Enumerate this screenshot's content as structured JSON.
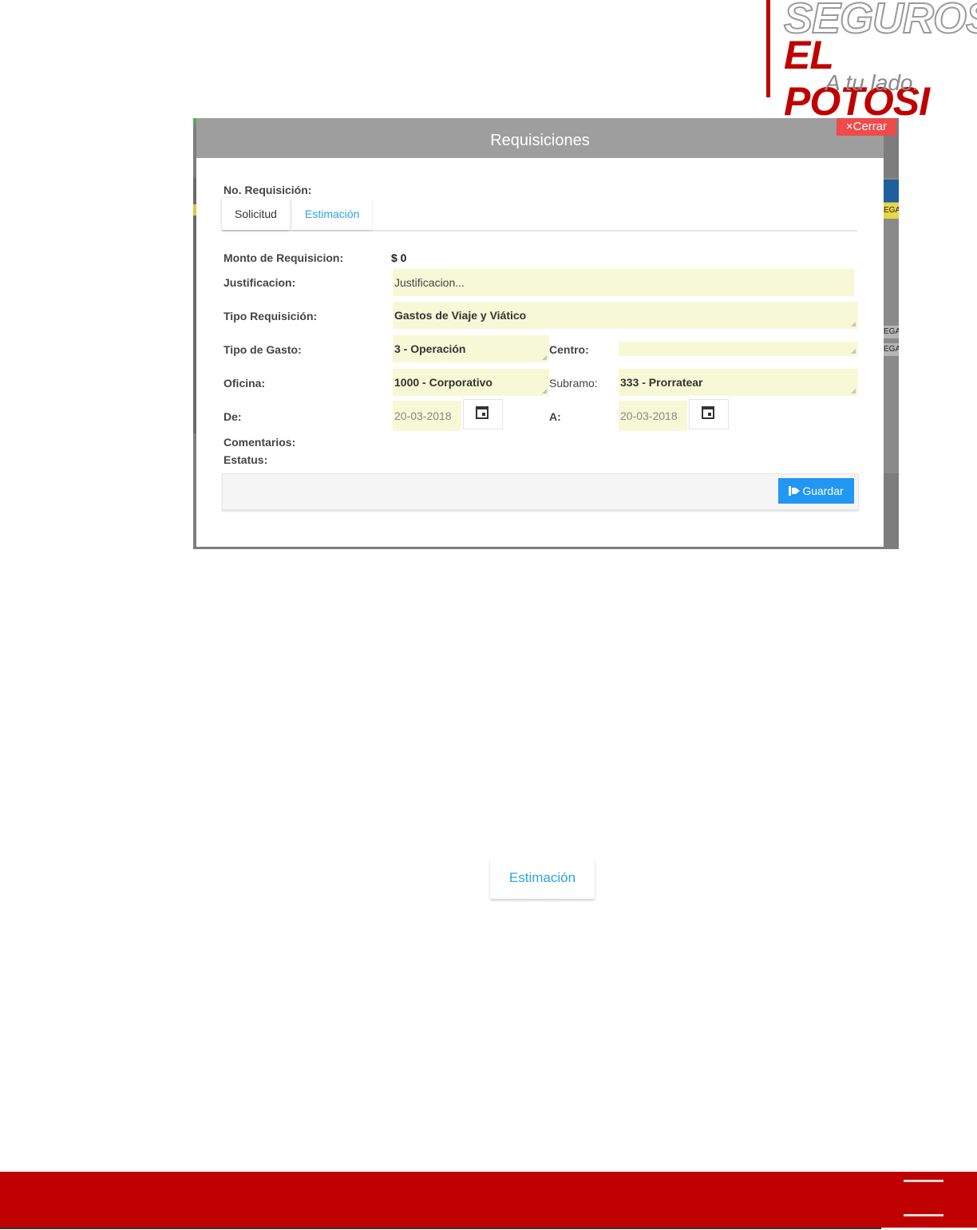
{
  "logo": {
    "line1": "SEGUROS",
    "line2": "EL POTOSI",
    "tagline": "A tu lado."
  },
  "modal": {
    "title": "Requisiciones",
    "close_label": "Cerrar",
    "requisition_label": "No. Requisición:",
    "tabs": [
      {
        "label": "Solicitud"
      },
      {
        "label": "Estimación"
      }
    ],
    "form": {
      "amount_label": "Monto de Requisicion:",
      "amount_value": "$ 0",
      "justification_label": "Justificacion:",
      "justification_placeholder": "Justificacion...",
      "type_label": "Tipo Requisición:",
      "type_value": "Gastos de Viaje y Viático",
      "expense_label": "Tipo de Gasto:",
      "expense_value": "3 - Operación",
      "center_label": "Centro:",
      "center_value": "",
      "office_label": "Oficina:",
      "office_value": "1000 - Corporativo",
      "subramo_label": "Subramo:",
      "subramo_value": "333 - Prorratear",
      "from_label": "De:",
      "from_value": "20-03-2018",
      "to_label": "A:",
      "to_value": "20-03-2018",
      "comments_label": "Comentarios:",
      "status_label": "Estatus:"
    },
    "save_label": "Guardar"
  },
  "background_fragments": {
    "right_cell_1": "EGA",
    "right_cell_2": "EGA",
    "right_cell_3": "EGA"
  },
  "tab_detail_label": "Estimación",
  "colors": {
    "brand_red": "#c00000",
    "accent_blue": "#2196f3",
    "tab_active": "#2aa4e8",
    "close_red": "#ef4b4b",
    "field_bg": "#f7f8d6"
  }
}
